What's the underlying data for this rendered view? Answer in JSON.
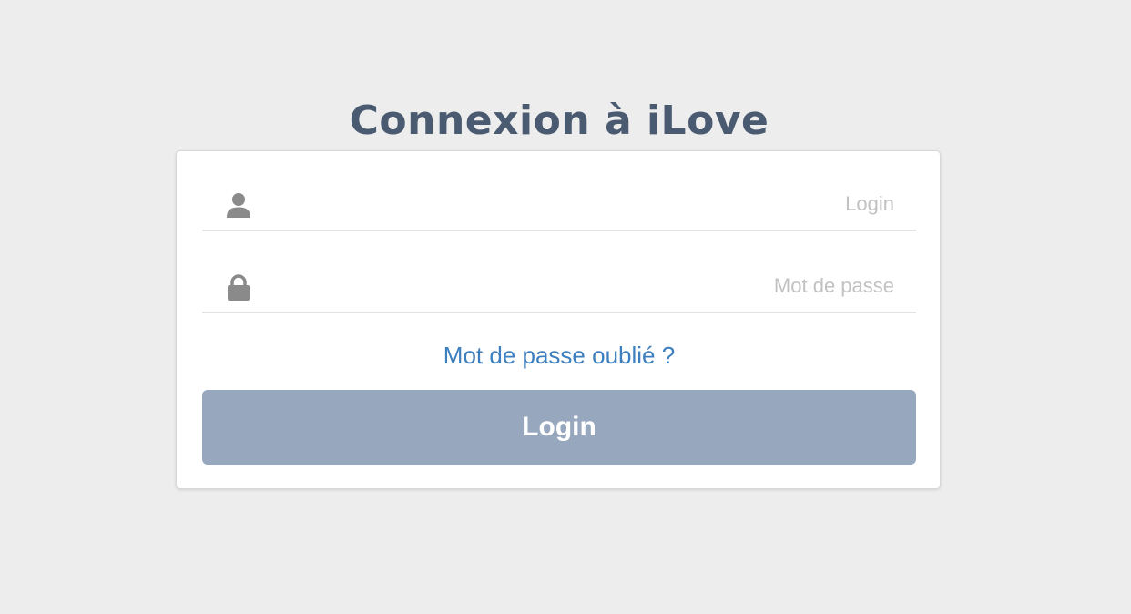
{
  "page": {
    "title": "Connexion à iLove"
  },
  "form": {
    "login_field": {
      "icon": "user-icon",
      "value": "",
      "placeholder": "Login"
    },
    "password_field": {
      "icon": "lock-icon",
      "value": "",
      "placeholder": "Mot de passe"
    },
    "forgot_password_label": "Mot de passe oublié ?",
    "submit_label": "Login"
  },
  "colors": {
    "background": "#ededed",
    "title": "#4a5a70",
    "link": "#3d7fbf",
    "button": "#96a7be",
    "icon": "#8a8a8a"
  }
}
